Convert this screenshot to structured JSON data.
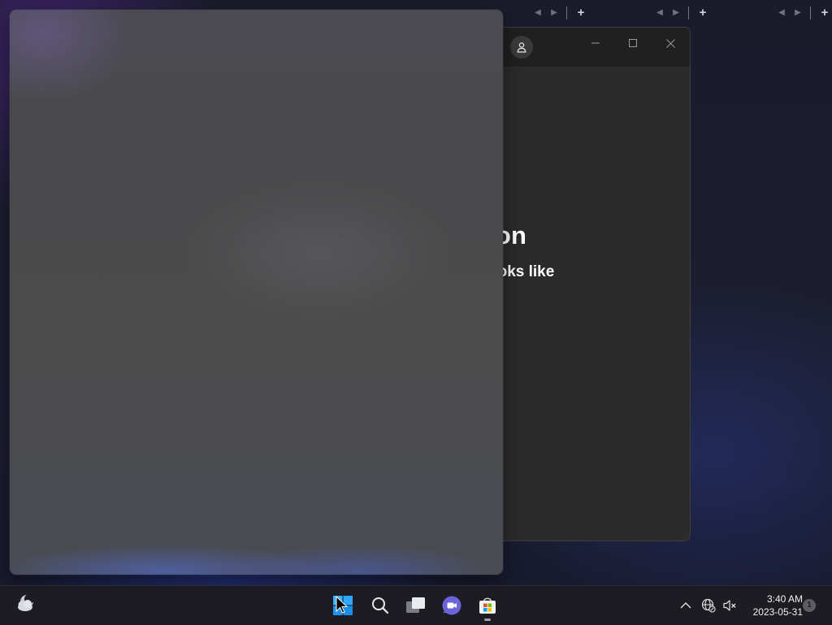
{
  "background_window": {
    "heading": "ion",
    "subheading": "ooks like"
  },
  "taskbar": {
    "clock": {
      "time": "3:40 AM",
      "date": "2023-05-31"
    },
    "notification_count": "1"
  },
  "icons": {
    "account": "person-icon",
    "minimize": "minimize-icon",
    "maximize": "maximize-icon",
    "close": "close-icon",
    "weather": "cloud-moon-icon",
    "start": "windows-logo-icon",
    "search": "search-icon",
    "task_view": "task-view-icon",
    "chat": "teams-chat-icon",
    "store": "microsoft-store-icon",
    "tray_overflow": "chevron-up-icon",
    "network": "globe-network-icon",
    "volume": "volume-muted-icon"
  },
  "colors": {
    "accent": "#2ea8ff",
    "window_bg": "#2b2b2b",
    "titlebar_bg": "#202020",
    "pane_bg": "#4b4b4c",
    "taskbar_bg": "#1c1c22"
  }
}
